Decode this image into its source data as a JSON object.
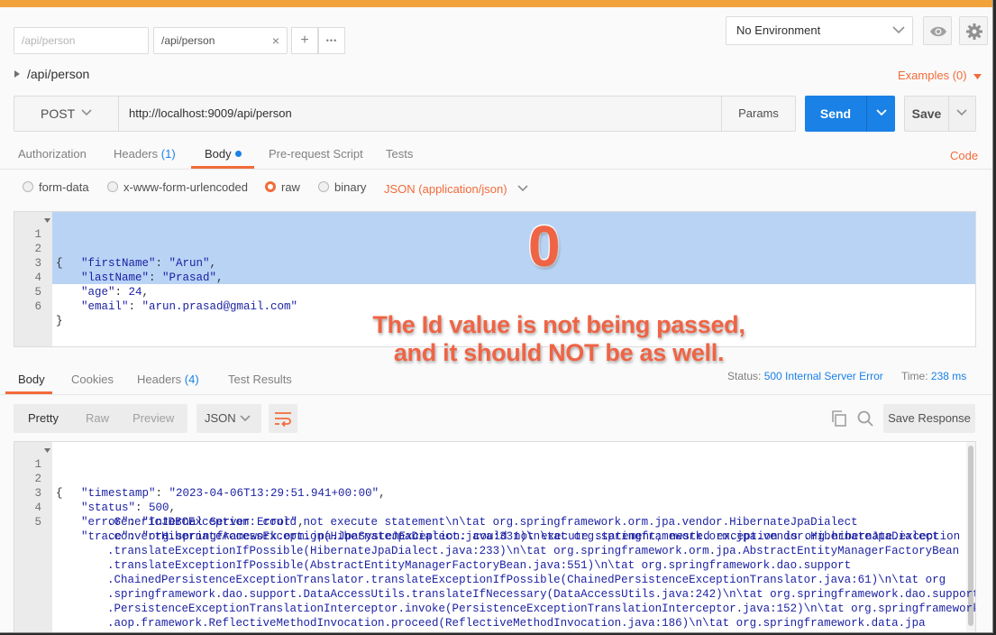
{
  "tabs": [
    {
      "label": "/api/person",
      "placeholder": true
    },
    {
      "label": "/api/person",
      "close": "×"
    }
  ],
  "tab_actions": {
    "add": "+",
    "more": "•••"
  },
  "environment": {
    "selected": "No Environment"
  },
  "request": {
    "title": "/api/person",
    "examples": "Examples (0)",
    "method": "POST",
    "url": "http://localhost:9009/api/person",
    "params_label": "Params",
    "send_label": "Send",
    "save_label": "Save"
  },
  "request_tabs": {
    "authorization": "Authorization",
    "headers": "Headers",
    "headers_count": "(1)",
    "body": "Body",
    "prerequest": "Pre-request Script",
    "tests": "Tests",
    "code": "Code"
  },
  "body_modes": {
    "form_data": "form-data",
    "urlencoded": "x-www-form-urlencoded",
    "raw": "raw",
    "binary": "binary",
    "content_type": "JSON (application/json)"
  },
  "request_body": {
    "line_numbers": [
      "1",
      "2",
      "3",
      "4",
      "5",
      "6"
    ],
    "l1": "{",
    "l2_key": "\"firstName\"",
    "l2_val": "\"Arun\"",
    "l3_key": "\"lastName\"",
    "l3_val": "\"Prasad\"",
    "l4_key": "\"age\"",
    "l4_val": "24",
    "l5_key": "\"email\"",
    "l5_val": "\"arun.prasad@gmail.com\"",
    "l6": "}"
  },
  "annotation": {
    "marker": "0",
    "line1": "The Id value is not being passed,",
    "line2": "and it should NOT be as well."
  },
  "response_tabs": {
    "body": "Body",
    "cookies": "Cookies",
    "headers": "Headers",
    "headers_count": "(4)",
    "test_results": "Test Results"
  },
  "response_status": {
    "status_label": "Status:",
    "status_value": "500 Internal Server Error",
    "time_label": "Time:",
    "time_value": "238 ms"
  },
  "response_view": {
    "pretty": "Pretty",
    "raw": "Raw",
    "preview": "Preview",
    "format": "JSON",
    "save_response": "Save Response"
  },
  "response_body": {
    "line_numbers": [
      "1",
      "2",
      "3",
      "4",
      "5"
    ],
    "l1": "{",
    "l2_key": "\"timestamp\"",
    "l2_val": "\"2023-04-06T13:29:51.941+00:00\"",
    "l3_key": "\"status\"",
    "l3_val": "500",
    "l4_key": "\"error\"",
    "l4_val": "\"Internal Server Error\"",
    "l5_key": "\"trace\"",
    "trace_lines": [
      "\"org.springframework.orm.jpa.JpaSystemException: could not execute statement; nested exception is org.hibernate.exception",
      ".GenericJDBCException: could not execute statement\\n\\tat org.springframework.orm.jpa.vendor.HibernateJpaDialect",
      ".convertHibernateAccessException(HibernateJpaDialect.java:331)\\n\\tat org.springframework.orm.jpa.vendor.HibernateJpaDialect",
      ".translateExceptionIfPossible(HibernateJpaDialect.java:233)\\n\\tat org.springframework.orm.jpa.AbstractEntityManagerFactoryBean",
      ".translateExceptionIfPossible(AbstractEntityManagerFactoryBean.java:551)\\n\\tat org.springframework.dao.support",
      ".ChainedPersistenceExceptionTranslator.translateExceptionIfPossible(ChainedPersistenceExceptionTranslator.java:61)\\n\\tat org",
      ".springframework.dao.support.DataAccessUtils.translateIfNecessary(DataAccessUtils.java:242)\\n\\tat org.springframework.dao.support",
      ".PersistenceExceptionTranslationInterceptor.invoke(PersistenceExceptionTranslationInterceptor.java:152)\\n\\tat org.springframework",
      ".aop.framework.ReflectiveMethodInvocation.proceed(ReflectiveMethodInvocation.java:186)\\n\\tat org.springframework.data.jpa"
    ]
  },
  "colors": {
    "accent": "#f26b3a",
    "send_blue": "#1a81e6",
    "annotation": "#ef6445"
  }
}
